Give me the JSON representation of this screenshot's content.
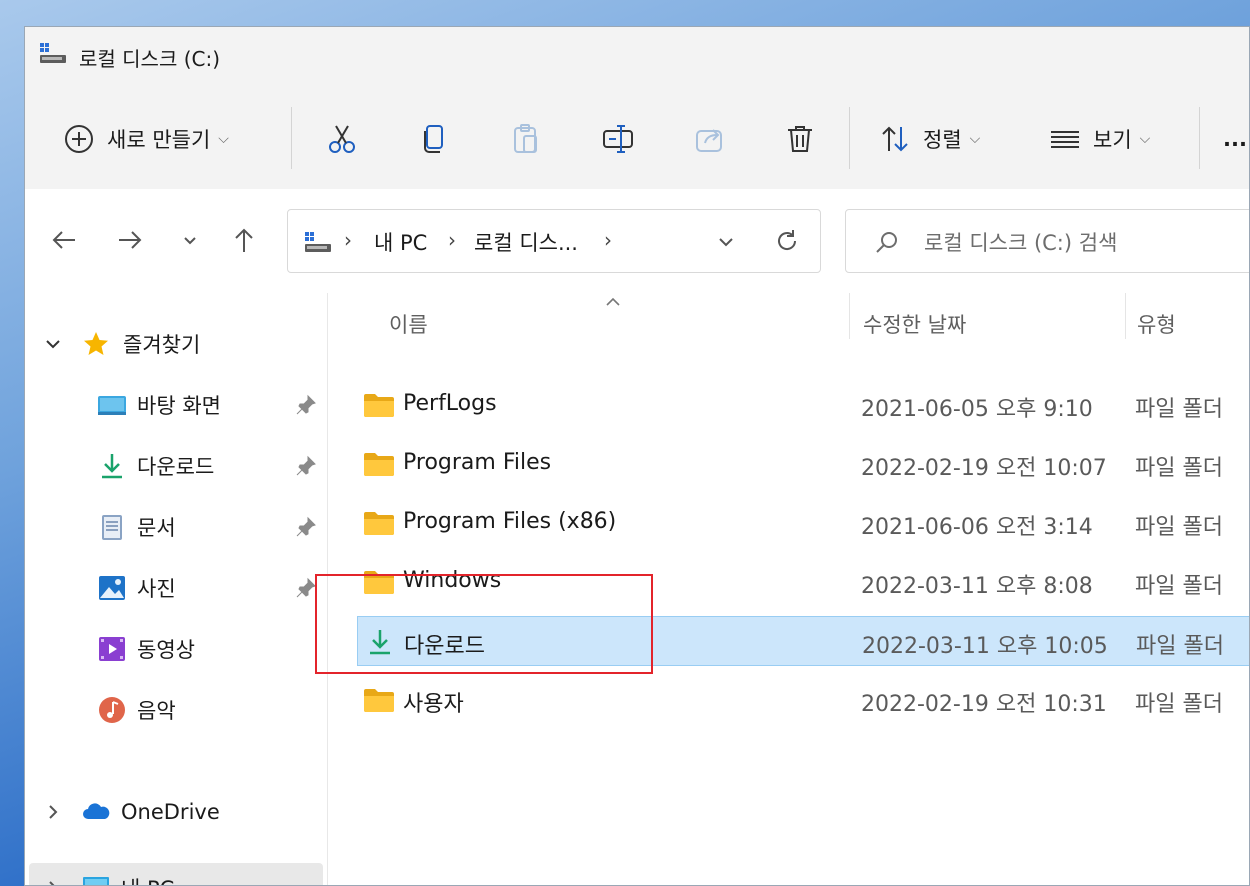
{
  "window": {
    "title": "로컬 디스크 (C:)"
  },
  "toolbar": {
    "new_label": "새로 만들기",
    "sort_label": "정렬",
    "view_label": "보기",
    "more_label": "..."
  },
  "address": {
    "crumbs": [
      "내 PC",
      "로컬 디스..."
    ],
    "search_placeholder": "로컬 디스크 (C:) 검색"
  },
  "sidebar": {
    "favorites_label": "즐겨찾기",
    "items": [
      {
        "label": "바탕 화면",
        "icon": "desktop-icon",
        "pinned": true
      },
      {
        "label": "다운로드",
        "icon": "download-icon",
        "pinned": true
      },
      {
        "label": "문서",
        "icon": "document-icon",
        "pinned": true
      },
      {
        "label": "사진",
        "icon": "pictures-icon",
        "pinned": true
      },
      {
        "label": "동영상",
        "icon": "videos-icon",
        "pinned": false
      },
      {
        "label": "음악",
        "icon": "music-icon",
        "pinned": false
      }
    ],
    "onedrive_label": "OneDrive",
    "thispc_label": "내 PC"
  },
  "columns": {
    "name": "이름",
    "date": "수정한 날짜",
    "type": "유형"
  },
  "files": [
    {
      "name": "PerfLogs",
      "date": "2021-06-05 오후 9:10",
      "type": "파일 폴더",
      "icon": "folder-icon"
    },
    {
      "name": "Program Files",
      "date": "2022-02-19 오전 10:07",
      "type": "파일 폴더",
      "icon": "folder-icon"
    },
    {
      "name": "Program Files (x86)",
      "date": "2021-06-06 오전 3:14",
      "type": "파일 폴더",
      "icon": "folder-icon"
    },
    {
      "name": "Windows",
      "date": "2022-03-11 오후 8:08",
      "type": "파일 폴더",
      "icon": "folder-icon"
    },
    {
      "name": "다운로드",
      "date": "2022-03-11 오후 10:05",
      "type": "파일 폴더",
      "icon": "download-icon",
      "selected": true
    },
    {
      "name": "사용자",
      "date": "2022-02-19 오전 10:31",
      "type": "파일 폴더",
      "icon": "folder-icon"
    }
  ],
  "colors": {
    "selected_row": "#cce6fb",
    "highlight_box": "#e3242b",
    "accent": "#0067c0"
  }
}
